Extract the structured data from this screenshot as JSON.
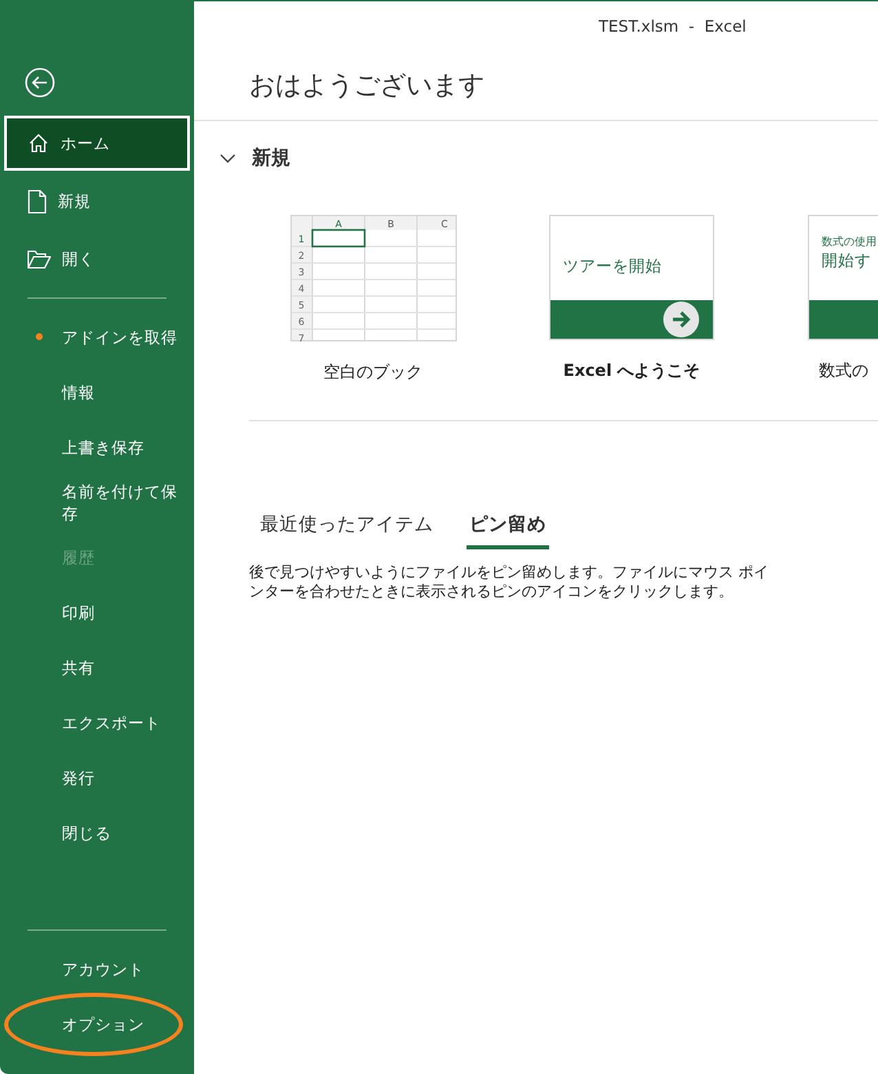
{
  "window": {
    "title": "TEST.xlsm  -  Excel"
  },
  "sidebar": {
    "sections": [
      {
        "items": [
          {
            "label": "ホーム",
            "selected": true,
            "disabled": false,
            "dot": false,
            "highlighted": false
          },
          {
            "label": "新規",
            "selected": false,
            "disabled": false,
            "dot": false,
            "highlighted": false
          },
          {
            "label": "開く",
            "selected": false,
            "disabled": false,
            "dot": false,
            "highlighted": false
          }
        ]
      },
      {
        "items": [
          {
            "label": "アドインを取得",
            "selected": false,
            "disabled": false,
            "dot": true,
            "highlighted": false
          },
          {
            "label": "情報",
            "selected": false,
            "disabled": false,
            "dot": false,
            "highlighted": false
          },
          {
            "label": "上書き保存",
            "selected": false,
            "disabled": false,
            "dot": false,
            "highlighted": false
          },
          {
            "label": "名前を付けて保存",
            "selected": false,
            "disabled": false,
            "dot": false,
            "highlighted": false
          },
          {
            "label": "履歴",
            "selected": false,
            "disabled": true,
            "dot": false,
            "highlighted": false
          },
          {
            "label": "印刷",
            "selected": false,
            "disabled": false,
            "dot": false,
            "highlighted": false
          },
          {
            "label": "共有",
            "selected": false,
            "disabled": false,
            "dot": false,
            "highlighted": false
          },
          {
            "label": "エクスポート",
            "selected": false,
            "disabled": false,
            "dot": false,
            "highlighted": false
          },
          {
            "label": "発行",
            "selected": false,
            "disabled": false,
            "dot": false,
            "highlighted": false
          },
          {
            "label": "閉じる",
            "selected": false,
            "disabled": false,
            "dot": false,
            "highlighted": false
          }
        ]
      },
      {
        "items": [
          {
            "label": "アカウント",
            "selected": false,
            "disabled": false,
            "dot": false,
            "highlighted": false
          },
          {
            "label": "オプション",
            "selected": false,
            "disabled": false,
            "dot": false,
            "highlighted": true
          }
        ]
      }
    ]
  },
  "greeting": "おはようございます",
  "new_section": {
    "title": "新規",
    "expanded": true,
    "templates": [
      {
        "kind": "blank",
        "label": "空白のブック",
        "columns": [
          "A",
          "B",
          "C"
        ],
        "rows": [
          "1",
          "2",
          "3",
          "4",
          "5",
          "6",
          "7"
        ]
      },
      {
        "kind": "tour",
        "label": "Excel へようこそ",
        "heading": "ツアーを開始"
      },
      {
        "kind": "formula",
        "label": "数式の",
        "subtitle": "数式の使用",
        "heading": "開始す"
      }
    ]
  },
  "tabs": [
    {
      "label": "最近使ったアイテム",
      "selected": false
    },
    {
      "label": "ピン留め",
      "selected": true
    }
  ],
  "description": "後で見つけやすいようにファイルをピン留めします。ファイルにマウス ポインターを合わせたときに表示されるピンのアイコンをクリックします。"
}
